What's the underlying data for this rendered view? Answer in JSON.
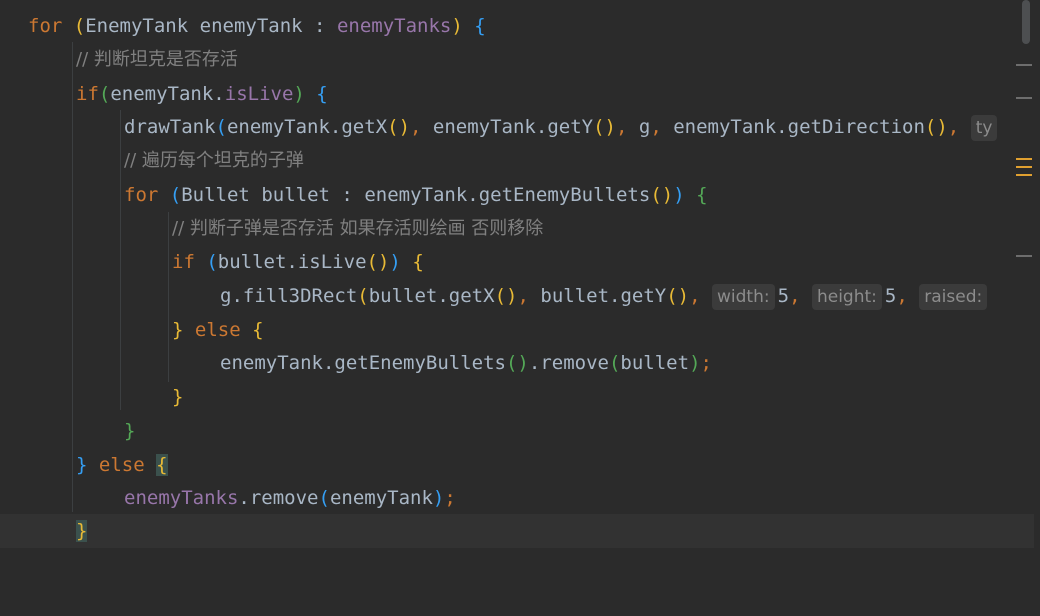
{
  "editor": {
    "lines": {
      "l1": {
        "kw_for": "for",
        "p_open": "(",
        "type": "EnemyTank",
        "var": "enemyTank",
        "colon": ":",
        "coll": "enemyTanks",
        "p_close": ")",
        "brace": "{"
      },
      "l2": {
        "comment": "// 判断坦克是否存活"
      },
      "l3": {
        "kw_if": "if",
        "p_open": "(",
        "obj": "enemyTank",
        "dot": ".",
        "field": "isLive",
        "p_close": ")",
        "brace": "{"
      },
      "l4": {
        "fn": "drawTank",
        "p_open": "(",
        "a1": "enemyTank.",
        "m1": "getX",
        "a1p": "()",
        "comma1": ",",
        "a2": "enemyTank.",
        "m2": "getY",
        "a2p": "()",
        "comma2": ",",
        "a3": "g",
        "comma3": ",",
        "a4": "enemyTank.",
        "m4": "getDirection",
        "a4p": "()",
        "comma4": ",",
        "hint": "ty"
      },
      "l5": {
        "comment": "// 遍历每个坦克的子弹"
      },
      "l6": {
        "kw_for": "for",
        "p_open": "(",
        "type": "Bullet",
        "var": "bullet",
        "colon": ":",
        "expr": "enemyTank.getEnemyBullets",
        "inner": "()",
        "p_close": ")",
        "brace": "{"
      },
      "l7": {
        "comment": "// 判断子弹是否存活 如果存活则绘画 否则移除"
      },
      "l8": {
        "kw_if": "if",
        "p_open": "(",
        "expr": "bullet.isLive",
        "inner": "()",
        "p_close": ")",
        "brace": "{"
      },
      "l9": {
        "obj": "g.",
        "fn": "fill3DRect",
        "p_open": "(",
        "a1": "bullet.getX",
        "a1p": "()",
        "comma1": ",",
        "a2": "bullet.getY",
        "a2p": "()",
        "comma2": ",",
        "hint_width": "width:",
        "v_width": "5",
        "comma3": ",",
        "hint_height": "height:",
        "v_height": "5",
        "comma4": ",",
        "hint_raised": "raised:"
      },
      "l10": {
        "brace_close": "}",
        "kw_else": "else",
        "brace": "{"
      },
      "l11": {
        "obj": "enemyTank.getEnemyBullets",
        "inner": "()",
        "dot": ".",
        "method": "remove",
        "p_open": "(",
        "arg": "bullet",
        "p_close": ")",
        "semi": ";"
      },
      "l12": {
        "brace": "}"
      },
      "l13": {
        "brace": "}"
      },
      "l14": {
        "brace_close": "}",
        "kw_else": "else",
        "brace": "{"
      },
      "l15": {
        "coll": "enemyTanks",
        "dot": ".",
        "method": "remove",
        "p_open": "(",
        "arg": "enemyTank",
        "p_close": ")",
        "semi": ";"
      },
      "l16": {
        "brace": "}"
      }
    }
  },
  "colors": {
    "background": "#2b2b2b",
    "keyword": "#cc7832",
    "method": "#ffc66d",
    "field": "#9876aa",
    "comment": "#808080",
    "text": "#a9b7c6"
  }
}
